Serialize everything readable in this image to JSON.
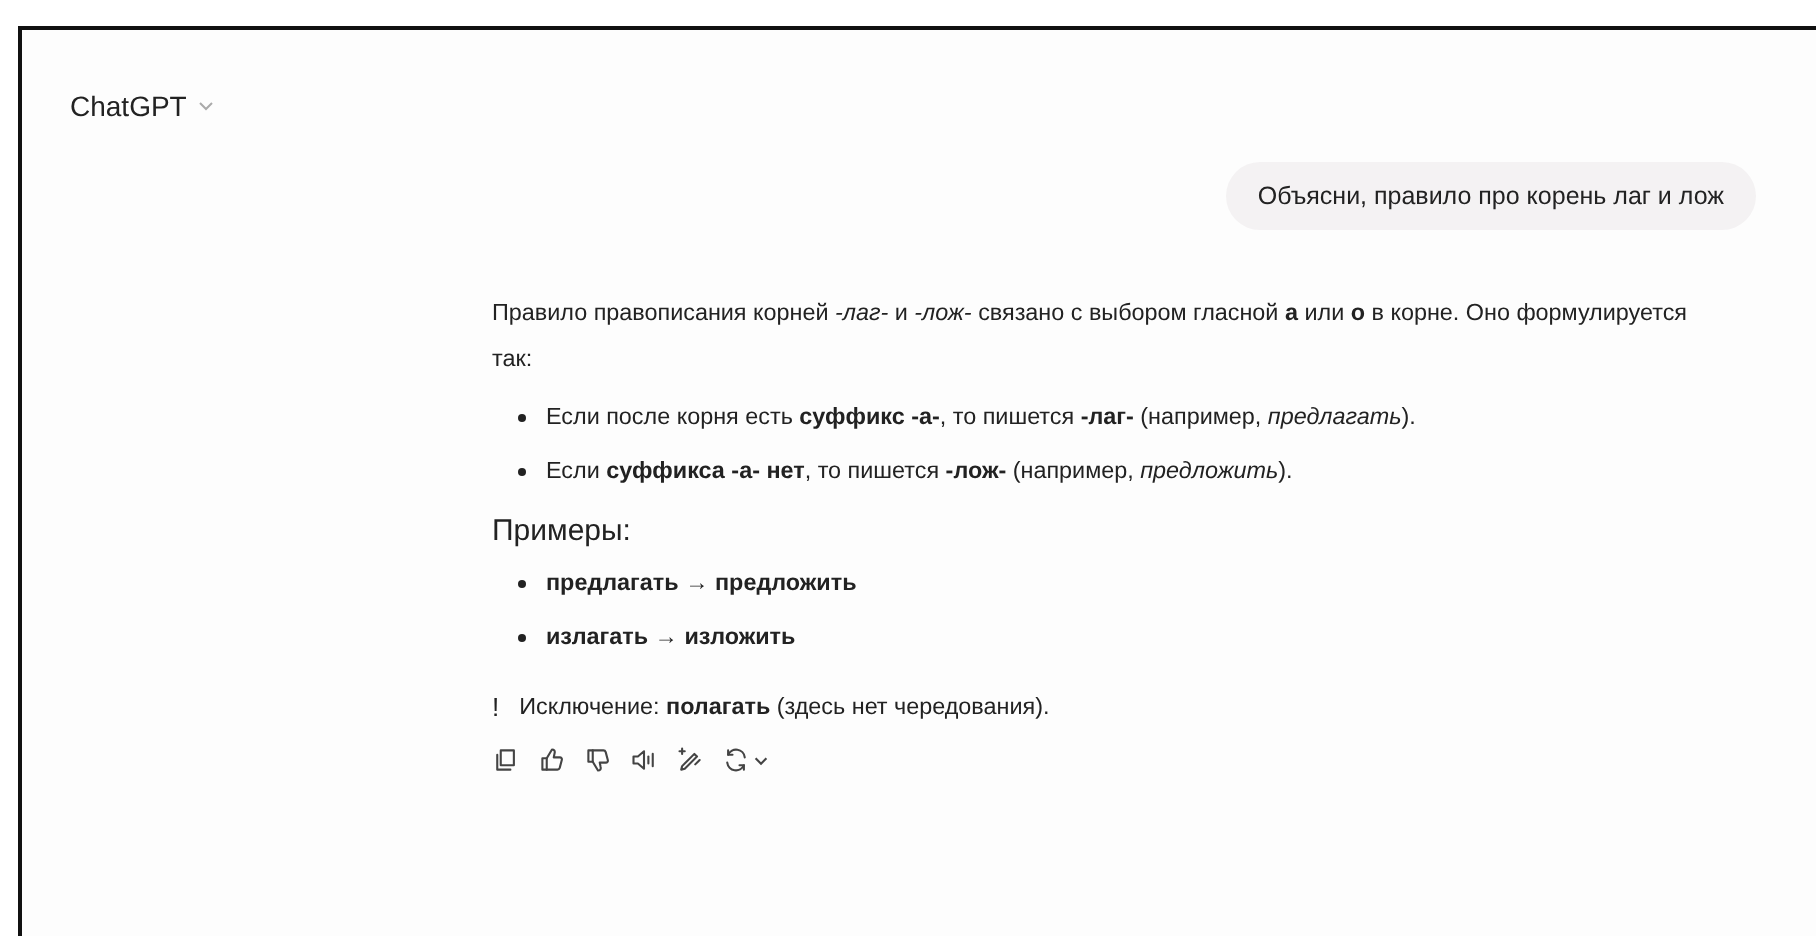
{
  "header": {
    "title": "ChatGPT"
  },
  "user_message": "Объясни, правило про корень лаг и лож",
  "answer": {
    "intro": "Правило правописания корней *-лаг-* и *-лож-* связано с выбором гласной **а** или **о** в корне. Оно формулируется так:",
    "rules": [
      "Если после корня есть **суффикс -а-**, то пишется **-лаг-** (например, *предлагать*).",
      "Если **суффикса -а- нет**, то пишется **-лож-** (например, *предложить*)."
    ],
    "examples_heading": "Примеры:",
    "examples": [
      "предлагать → предложить",
      "излагать → изложить"
    ],
    "note": {
      "mark": "!",
      "text": "Исключение: **полагать** (здесь нет чередования)."
    }
  },
  "actions": [
    {
      "kind": "copy"
    },
    {
      "kind": "like"
    },
    {
      "kind": "dislike"
    },
    {
      "kind": "speak"
    },
    {
      "kind": "edit"
    },
    {
      "kind": "regenerate"
    }
  ]
}
